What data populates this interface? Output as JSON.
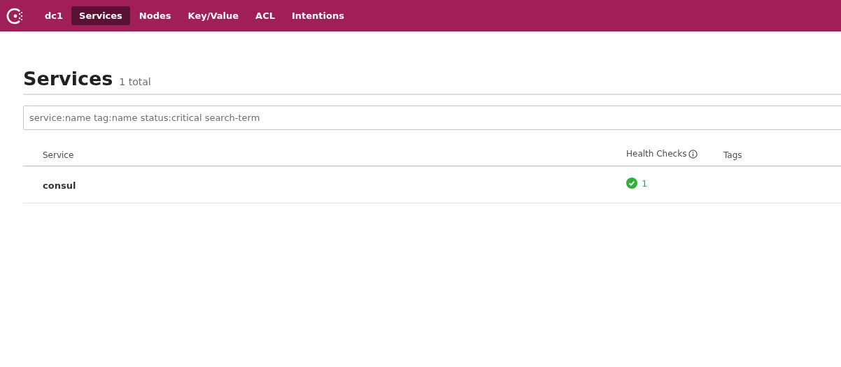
{
  "nav": {
    "datacenter": "dc1",
    "items": [
      {
        "label": "Services",
        "selected": true
      },
      {
        "label": "Nodes",
        "selected": false
      },
      {
        "label": "Key/Value",
        "selected": false
      },
      {
        "label": "ACL",
        "selected": false
      },
      {
        "label": "Intentions",
        "selected": false
      }
    ]
  },
  "page": {
    "title": "Services",
    "count": "1 total"
  },
  "search": {
    "placeholder": "service:name tag:name status:critical search-term"
  },
  "table": {
    "columns": [
      "Service",
      "Health Checks",
      "Tags"
    ],
    "rows": [
      {
        "service": "consul",
        "checks_passing": "1"
      }
    ]
  }
}
